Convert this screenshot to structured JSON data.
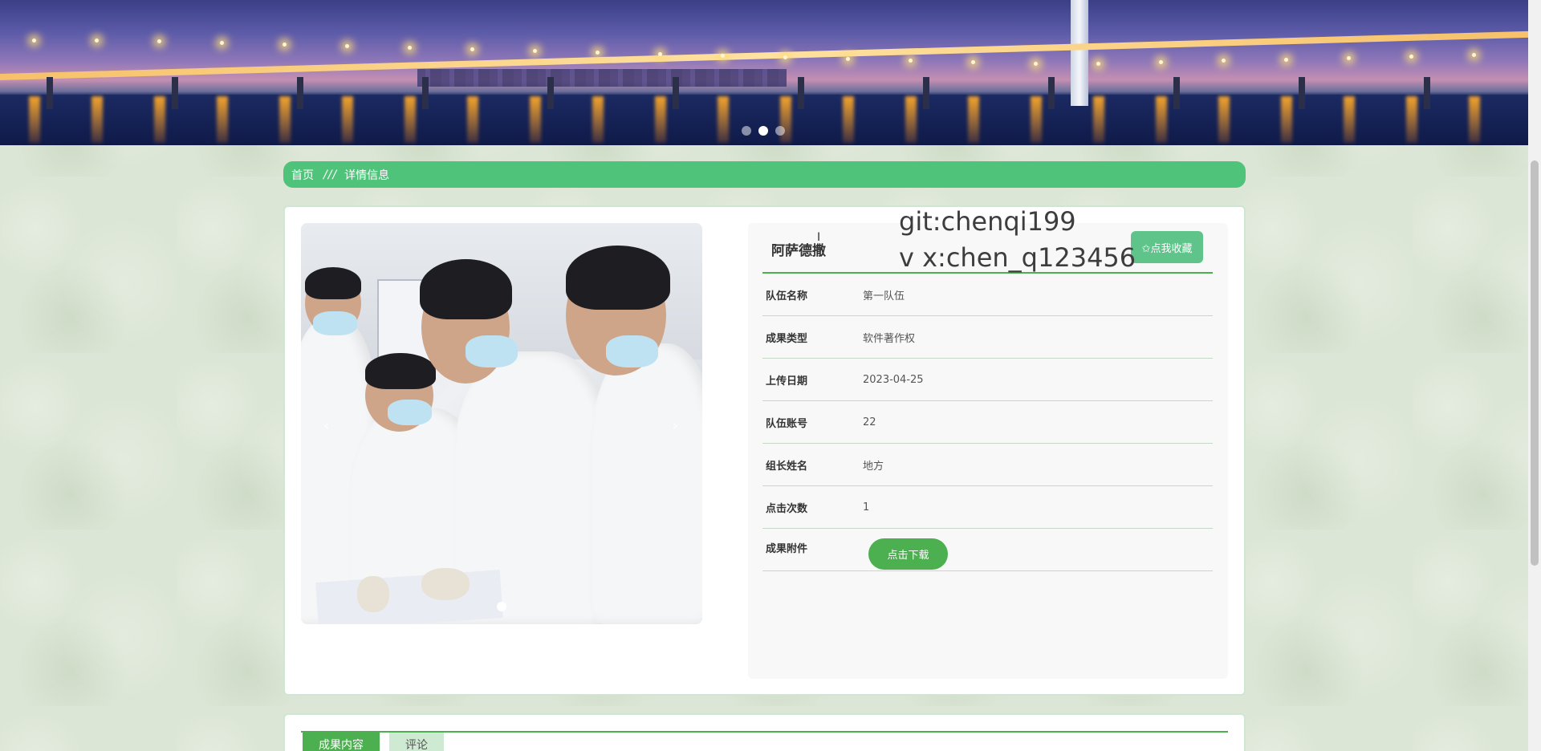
{
  "banner": {
    "slides": 3,
    "active_slide": 2
  },
  "breadcrumb": {
    "home": "首页",
    "separator": "///",
    "current": "详情信息"
  },
  "detail": {
    "title": "阿萨德撒",
    "favorite_label": "✩点我收藏",
    "fields": [
      {
        "label": "队伍名称",
        "value": "第一队伍"
      },
      {
        "label": "成果类型",
        "value": "软件著作权"
      },
      {
        "label": "上传日期",
        "value": "2023-04-25"
      },
      {
        "label": "队伍账号",
        "value": "22"
      },
      {
        "label": "组长姓名",
        "value": "地方"
      },
      {
        "label": "点击次数",
        "value": "1"
      }
    ],
    "attachment_label": "成果附件",
    "download_label": "点击下载"
  },
  "gallery": {
    "prev_icon": "‹",
    "next_icon": "›",
    "images": 1
  },
  "watermark": {
    "line1": "git:chenqi199",
    "line2": "v x:chen_q123456"
  },
  "tabs": [
    {
      "label": "成果内容",
      "active": true
    },
    {
      "label": "评论",
      "active": false
    }
  ],
  "colors": {
    "accent": "#4fc37a",
    "button": "#4caf50",
    "favorite": "#5ec48a"
  }
}
